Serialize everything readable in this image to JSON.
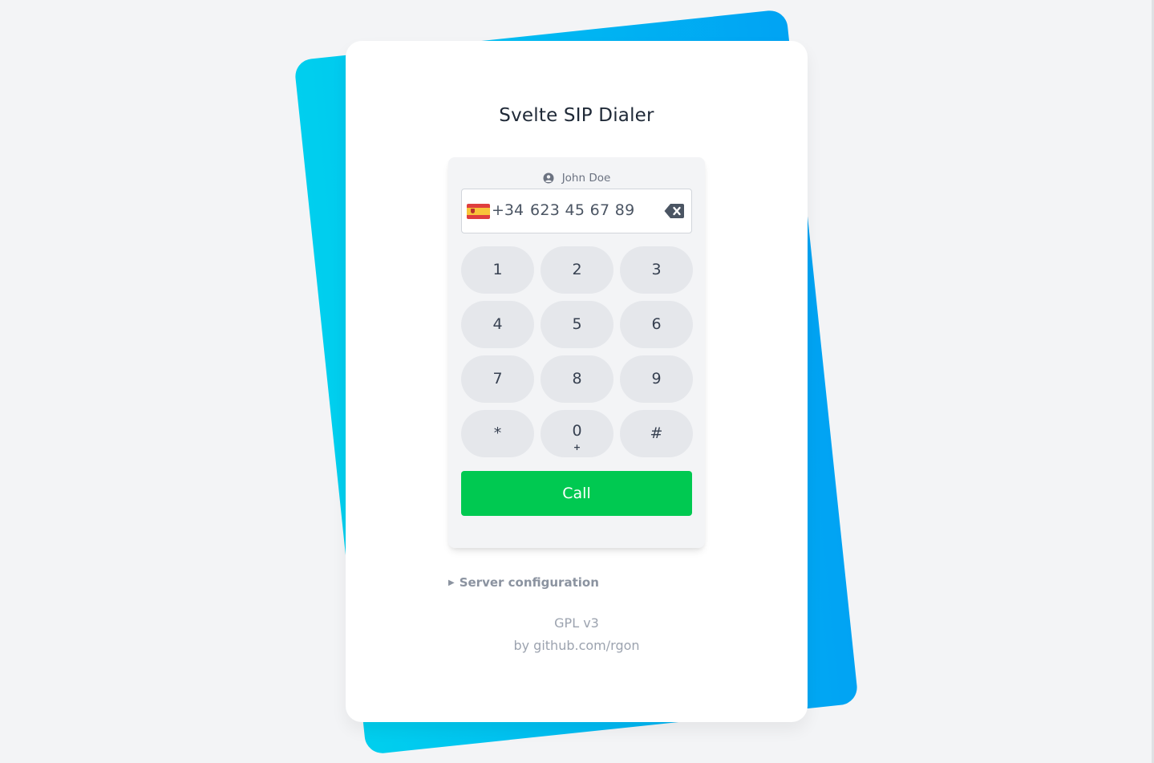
{
  "app": {
    "title": "Svelte SIP Dialer"
  },
  "user": {
    "name": "John Doe",
    "icon": "user-circle-icon"
  },
  "phone": {
    "flag": "es-flag-icon",
    "prefix": "+34",
    "number": "623 45 67 89",
    "backspace_icon": "backspace-icon"
  },
  "keypad": {
    "keys": [
      {
        "main": "1",
        "sub": ""
      },
      {
        "main": "2",
        "sub": ""
      },
      {
        "main": "3",
        "sub": ""
      },
      {
        "main": "4",
        "sub": ""
      },
      {
        "main": "5",
        "sub": ""
      },
      {
        "main": "6",
        "sub": ""
      },
      {
        "main": "7",
        "sub": ""
      },
      {
        "main": "8",
        "sub": ""
      },
      {
        "main": "9",
        "sub": ""
      },
      {
        "main": "*",
        "sub": ""
      },
      {
        "main": "0",
        "sub": "+"
      },
      {
        "main": "#",
        "sub": ""
      }
    ]
  },
  "call_label": "Call",
  "server_config_label": "Server configuration",
  "footer": {
    "license": "GPL v3",
    "author": "by github.com/rgon"
  },
  "colors": {
    "call": "#00c951",
    "accent_gradient_start": "#00cfee",
    "accent_gradient_end": "#01a3f3"
  }
}
